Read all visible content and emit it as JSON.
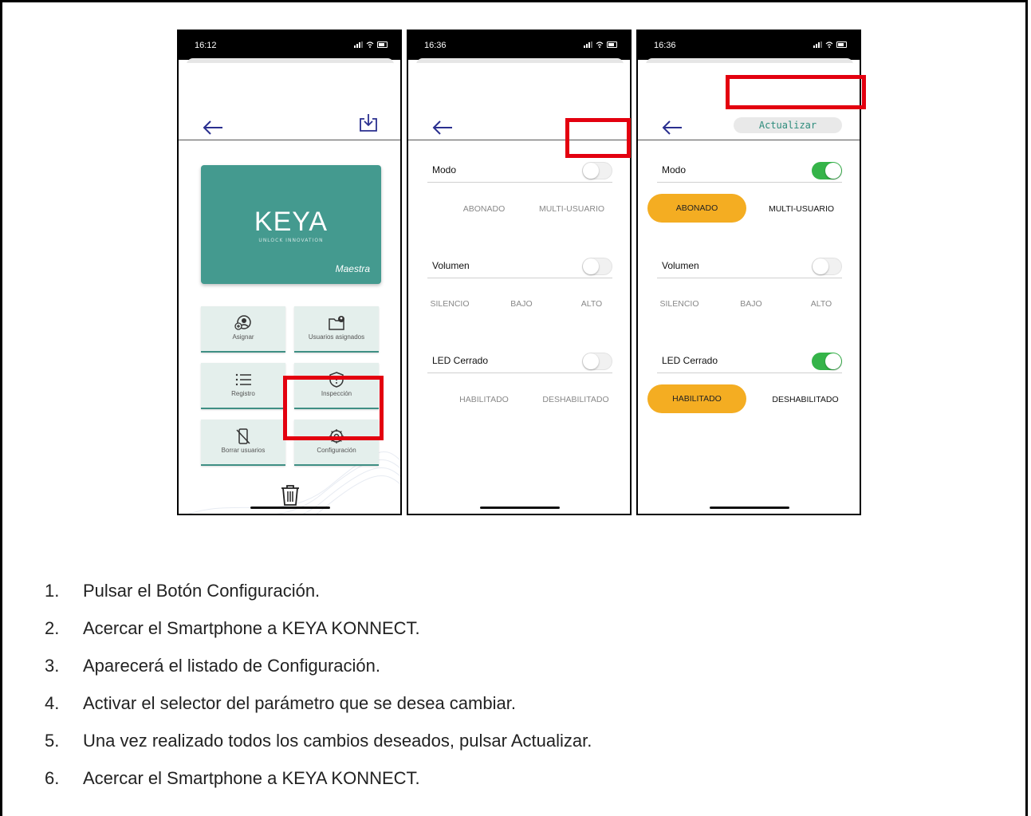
{
  "phones": [
    {
      "time": "16:12",
      "card": {
        "logo": "KEYA",
        "tagline": "UNLOCK INNOVATION",
        "label": "Maestra"
      },
      "tiles": [
        {
          "label": "Asignar",
          "icon": "user-add-icon"
        },
        {
          "label": "Usuarios asignados",
          "icon": "folder-user-icon"
        },
        {
          "label": "Registro",
          "icon": "list-icon"
        },
        {
          "label": "Inspección",
          "icon": "shield-alert-icon"
        },
        {
          "label": "Borrar usuarios",
          "icon": "phone-off-icon"
        },
        {
          "label": "Configuración",
          "icon": "gear-icon"
        }
      ]
    },
    {
      "time": "16:36",
      "modo": {
        "label": "Modo",
        "on": false,
        "options": [
          "ABONADO",
          "MULTI-USUARIO"
        ]
      },
      "volumen": {
        "label": "Volumen",
        "on": false,
        "options": [
          "SILENCIO",
          "BAJO",
          "ALTO"
        ]
      },
      "led": {
        "label": "LED Cerrado",
        "on": false,
        "options": [
          "HABILITADO",
          "DESHABILITADO"
        ]
      }
    },
    {
      "time": "16:36",
      "update_button": "Actualizar",
      "modo": {
        "label": "Modo",
        "on": true,
        "options": [
          "ABONADO",
          "MULTI-USUARIO"
        ],
        "selected": "ABONADO"
      },
      "volumen": {
        "label": "Volumen",
        "on": false,
        "options": [
          "SILENCIO",
          "BAJO",
          "ALTO"
        ]
      },
      "led": {
        "label": "LED Cerrado",
        "on": true,
        "options": [
          "HABILITADO",
          "DESHABILITADO"
        ],
        "selected": "HABILITADO"
      }
    }
  ],
  "colors": {
    "teal": "#449a8f",
    "highlight": "#e3000f",
    "selected": "#f4ad22",
    "toggle_on": "#35b449",
    "back_arrow": "#2a2f8f"
  },
  "steps": [
    {
      "num": "1.",
      "text": "Pulsar el Botón Configuración."
    },
    {
      "num": "2.",
      "text": "Acercar el Smartphone a KEYA KONNECT."
    },
    {
      "num": "3.",
      "text": "Aparecerá el listado de Configuración."
    },
    {
      "num": "4.",
      "text": "Activar el selector del parámetro que se desea cambiar."
    },
    {
      "num": "5.",
      "text": "Una vez realizado todos los cambios deseados, pulsar Actualizar."
    },
    {
      "num": "6.",
      "text": "Acercar el Smartphone a KEYA KONNECT."
    }
  ]
}
